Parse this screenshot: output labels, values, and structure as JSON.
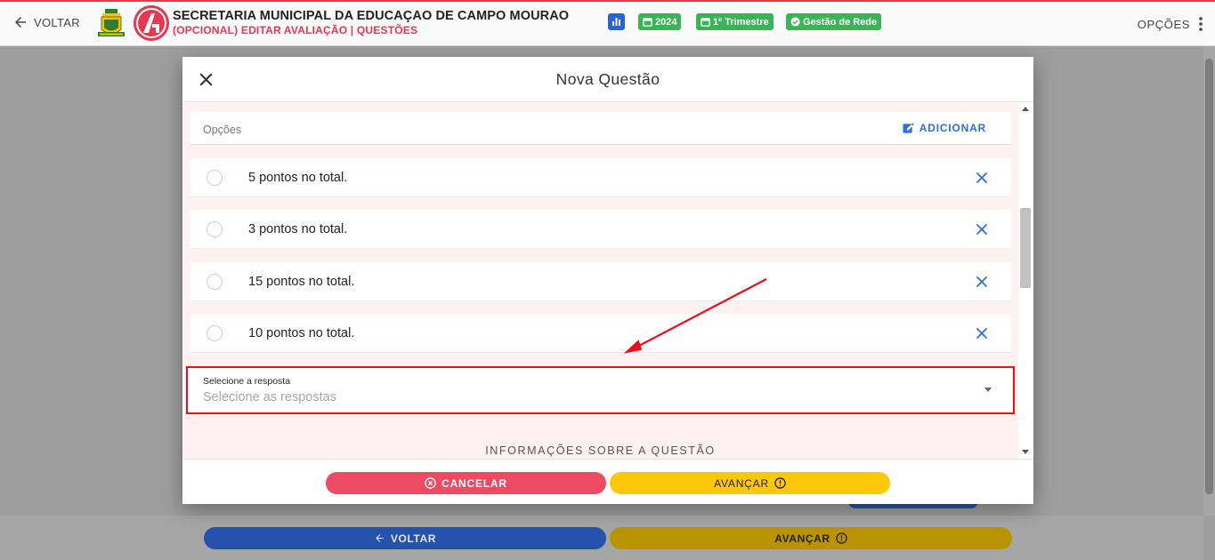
{
  "appbar": {
    "back_label": "VOLTAR",
    "title": "SECRETARIA MUNICIPAL DA EDUCAÇAO DE CAMPO MOURAO",
    "subtitle": "(OPCIONAL) EDITAR AVALIAÇÃO | QUESTÕES",
    "chips": [
      {
        "label": "2024",
        "icon": "calendar-icon"
      },
      {
        "label": "1º Trimestre",
        "icon": "calendar-icon"
      },
      {
        "label": "Gestão de Rede",
        "icon": "check-circle-icon"
      }
    ],
    "options_label": "OPÇÕES",
    "colors": {
      "accent": "#e53950",
      "chip": "#3bb357",
      "stats": "#2a62d8"
    }
  },
  "modal": {
    "title": "Nova Questão",
    "options_label": "Opções",
    "add_label": "ADICIONAR",
    "options": [
      "5 pontos no total.",
      "3 pontos no total.",
      "15 pontos no total.",
      "10 pontos no total."
    ],
    "answer_select": {
      "label": "Selecione a resposta",
      "placeholder": "Selecione as respostas"
    },
    "info_heading": "INFORMAÇÕES SOBRE A QUESTÃO",
    "cancel_label": "CANCELAR",
    "next_label": "AVANÇAR"
  },
  "background_footer": {
    "back_label": "VOLTAR",
    "next_label": "AVANÇAR"
  }
}
